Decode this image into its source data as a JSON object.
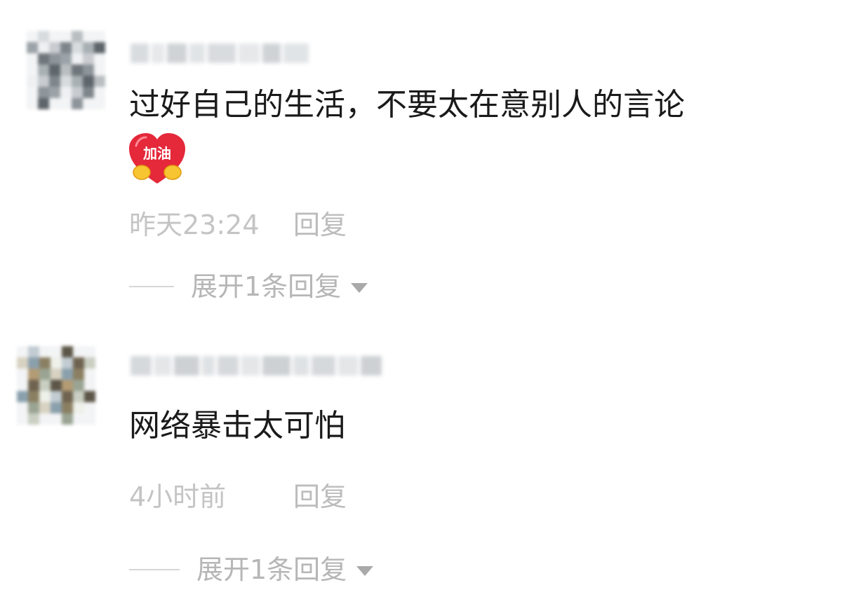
{
  "comments": [
    {
      "text": "过好自己的生活，不要太在意别人的言论",
      "sticker": {
        "icon": "cheer-heart-sticker",
        "label": "加油",
        "color": "#e5283a"
      },
      "time": "昨天23:24",
      "reply_label": "回复",
      "expand_label": "展开1条回复"
    },
    {
      "text": "网络暴击太可怕",
      "time": "4小时前",
      "reply_label": "回复",
      "expand_label": "展开1条回复"
    }
  ],
  "colors": {
    "text": "#1a1a1a",
    "meta": "#c4c4c4",
    "sticker_red": "#e5283a",
    "sticker_yellow": "#f7c531"
  }
}
